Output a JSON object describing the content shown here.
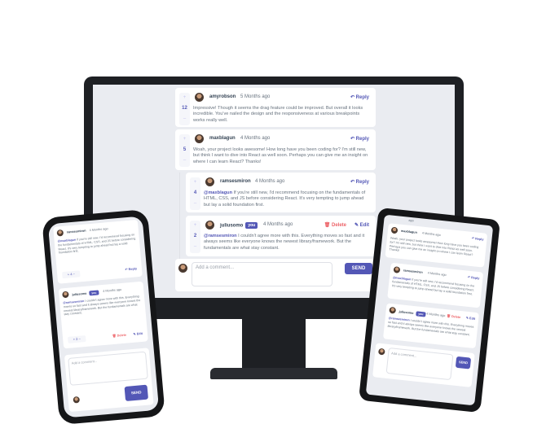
{
  "desktop": {
    "comments": [
      {
        "score": "12",
        "username": "amyrobson",
        "created": "5 Months ago",
        "action": "Reply",
        "content": "Impressive! Though it seems the drag feature could be improved. But overall it looks incredible. You've nailed the design and the responsiveness at various breakpoints works really well."
      },
      {
        "score": "5",
        "username": "maxblagun",
        "created": "4 Months ago",
        "action": "Reply",
        "content": "Woah, your project looks awesome! How long have you been coding for? I'm still new, but think I want to dive into React as well soon. Perhaps you can give me an insight on where I can learn React? Thanks!"
      }
    ],
    "replies": [
      {
        "score": "4",
        "username": "ramsesmiron",
        "created": "4 Months ago",
        "action": "Reply",
        "mention": "@maxblagun",
        "content": "If you're still new, I'd recommend focusing on the fundamentals of HTML, CSS, and JS before considering React. It's very tempting to jump ahead but lay a solid foundation first."
      },
      {
        "score": "2",
        "username": "juliusomo",
        "badge": "you",
        "created": "4 Months ago",
        "delete_label": "Delete",
        "edit_label": "Edit",
        "mention": "@ramsesmiron",
        "content": "I couldn't agree more with this. Everything moves so fast and it always seems like everyone knows the newest library/framework. But the fundamentals are what stay constant."
      }
    ],
    "composer": {
      "placeholder": "Add a comment...",
      "send_label": "SEND"
    }
  },
  "phone": {
    "reply1": {
      "username": "ramsesmiron",
      "created": "4 Months ago",
      "mention": "@maxblagun",
      "content": "If you're still new, I'd recommend focusing on the fundamentals of HTML, CSS, and JS before considering React. It's very tempting to jump ahead but lay a solid foundation first.",
      "score": "4",
      "action": "Reply"
    },
    "reply2": {
      "username": "juliusomo",
      "badge": "you",
      "created": "4 Months ago",
      "mention": "@ramsesmiron",
      "content": "I couldn't agree more with this. Everything moves so fast and it always seems like everyone knows the newest library/framework. But the fundamentals are what stay constant.",
      "score": "2",
      "delete_label": "Delete",
      "edit_label": "Edit"
    },
    "composer": {
      "placeholder": "Add a comment...",
      "send_label": "SEND"
    }
  },
  "tablet": {
    "top_time": "ago",
    "c1": {
      "username": "maxblagun",
      "created": "4 Months ago",
      "action": "Reply",
      "content": "Woah, your project looks awesome! How long have you been coding for? I'm still new, but think I want to dive into React as well soon. Perhaps you can give me an insight on where I can learn React? Thanks!"
    },
    "c2": {
      "username": "ramsesmiron",
      "created": "4 Months ago",
      "action": "Reply",
      "mention": "@maxblagun",
      "content": "If you're still new, I'd recommend focusing on the fundamentals of HTML, CSS, and JS before considering React. It's very tempting to jump ahead but lay a solid foundation first."
    },
    "c3": {
      "username": "juliusomo",
      "badge": "you",
      "created": "4 Months ago",
      "delete_label": "Delete",
      "edit_label": "Edit",
      "mention": "@ramsesmiron",
      "content": "I couldn't agree more with this. Everything moves so fast and it always seems like everyone knows the newest library/framework. But the fundamentals are what stay constant."
    },
    "composer": {
      "placeholder": "Add a comment...",
      "send_label": "SEND"
    }
  },
  "colors": {
    "accent": "#5357b6",
    "danger": "#ed6368",
    "background": "#eaecf1"
  }
}
